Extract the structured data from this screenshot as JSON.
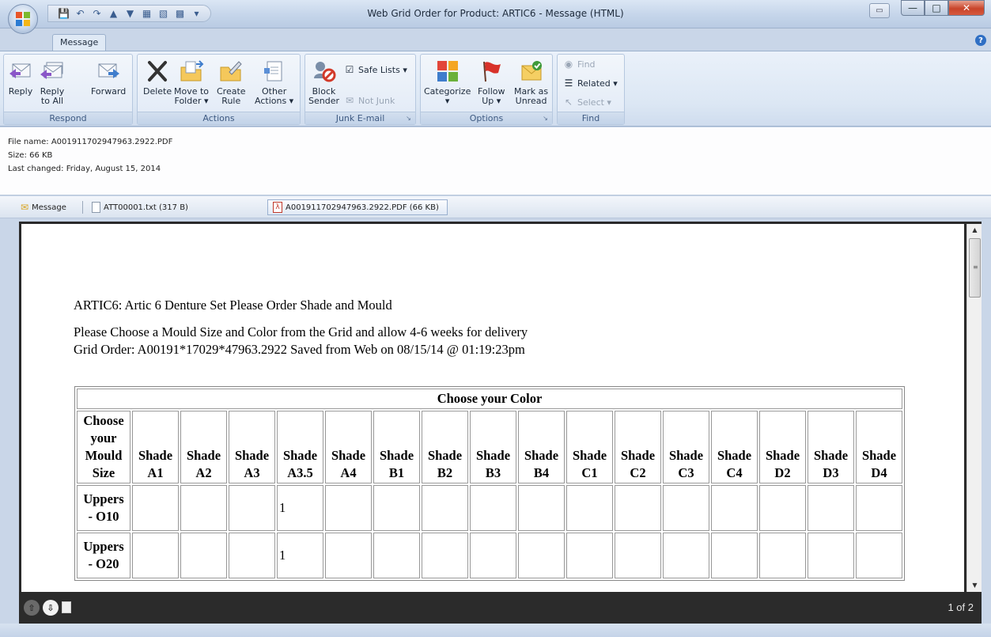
{
  "window": {
    "title": "Web Grid Order for Product: ARTIC6 - Message (HTML)"
  },
  "ribbon": {
    "active_tab": "Message",
    "groups": {
      "respond": {
        "label": "Respond",
        "reply": "Reply",
        "reply_all_1": "Reply",
        "reply_all_2": "to All",
        "forward": "Forward"
      },
      "actions": {
        "label": "Actions",
        "delete": "Delete",
        "move_1": "Move to",
        "move_2": "Folder ▾",
        "create_1": "Create",
        "create_2": "Rule",
        "other_1": "Other",
        "other_2": "Actions ▾"
      },
      "junk": {
        "label": "Junk E-mail",
        "block_1": "Block",
        "block_2": "Sender",
        "safe_lists": "Safe Lists ▾",
        "not_junk": "Not Junk"
      },
      "options": {
        "label": "Options",
        "categorize_1": "Categorize",
        "categorize_2": "▾",
        "follow_1": "Follow",
        "follow_2": "Up ▾",
        "mark_1": "Mark as",
        "mark_2": "Unread"
      },
      "find": {
        "label": "Find",
        "find": "Find",
        "related": "Related ▾",
        "select": "Select ▾"
      }
    }
  },
  "file_info": {
    "name": "File name:  A001911702947963.2922.PDF",
    "size": "Size:  66 KB",
    "changed": "Last changed:  Friday, August 15, 2014"
  },
  "attachments": [
    {
      "label": "Message"
    },
    {
      "label": "ATT00001.txt (317 B)"
    },
    {
      "label": "A001911702947963.2922.PDF (66 KB)"
    }
  ],
  "document": {
    "heading": "ARTIC6: Artic 6 Denture Set Please Order Shade and Mould",
    "instruction": "Please Choose a Mould Size and Color from the Grid and allow 4-6 weeks for delivery",
    "grid_order": "Grid Order: A00191*17029*47963.2922 Saved from Web on 08/15/14 @ 01:19:23pm",
    "table": {
      "title": "Choose your Color",
      "mould_header": [
        "Choose",
        "your",
        "Mould",
        "Size"
      ],
      "shade_word": "Shade",
      "shades": [
        "A1",
        "A2",
        "A3",
        "A3.5",
        "A4",
        "B1",
        "B2",
        "B3",
        "B4",
        "C1",
        "C2",
        "C3",
        "C4",
        "D2",
        "D3",
        "D4"
      ],
      "rows": [
        {
          "label_1": "Uppers",
          "label_2": "- O10",
          "values": [
            "",
            "",
            "",
            "1",
            "",
            "",
            "",
            "",
            "",
            "",
            "",
            "",
            "",
            "",
            "",
            ""
          ]
        },
        {
          "label_1": "Uppers",
          "label_2": "- O20",
          "values": [
            "",
            "",
            "",
            "1",
            "",
            "",
            "",
            "",
            "",
            "",
            "",
            "",
            "",
            "",
            "",
            ""
          ]
        }
      ]
    }
  },
  "viewer": {
    "page_count": "1 of 2"
  }
}
